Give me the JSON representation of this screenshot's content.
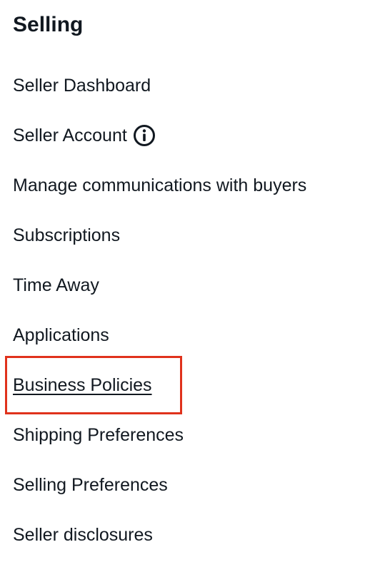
{
  "section": {
    "title": "Selling"
  },
  "menu": {
    "items": [
      {
        "label": "Seller Dashboard"
      },
      {
        "label": "Seller Account",
        "icon": "info-icon"
      },
      {
        "label": "Manage communications with buyers"
      },
      {
        "label": "Subscriptions"
      },
      {
        "label": "Time Away"
      },
      {
        "label": "Applications"
      },
      {
        "label": "Business Policies",
        "highlighted": true
      },
      {
        "label": "Shipping Preferences"
      },
      {
        "label": "Selling Preferences"
      },
      {
        "label": "Seller disclosures"
      }
    ]
  },
  "colors": {
    "text": "#111820",
    "highlight_border": "#e0321c",
    "background": "#ffffff"
  }
}
